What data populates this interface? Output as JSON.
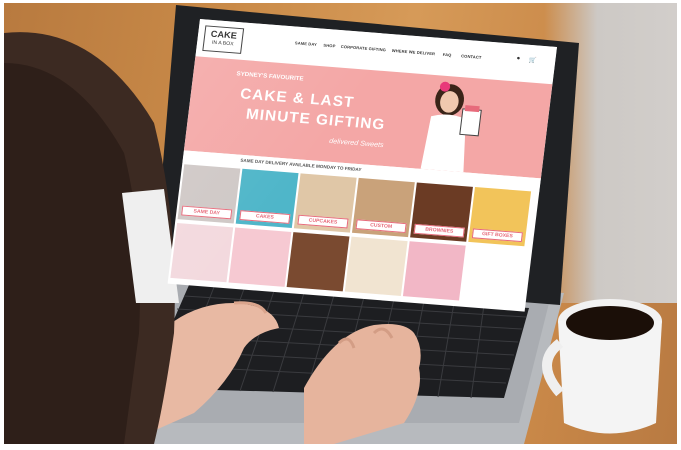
{
  "scene": {
    "colors": {
      "table": "#c98a48",
      "wall": "#d2cecb",
      "laptop": "#b9bcc0",
      "screen_bezel": "#1f2124",
      "hero_pink": "#f4a7a6",
      "label_pink": "#e76b7b",
      "coffee": "#1b0f08"
    }
  },
  "website": {
    "logo": {
      "line1": "CAKE",
      "line2": "IN A BOX"
    },
    "nav": [
      "SAME DAY",
      "SHOP",
      "CORPORATE GIFTING",
      "WHERE WE DELIVER",
      "FAQ",
      "CONTACT"
    ],
    "nav_icons": [
      "user-icon",
      "cart-icon"
    ],
    "hero": {
      "small_line": "SYDNEY'S FAVOURITE",
      "headline_line1": "CAKE & LAST",
      "headline_line2": "MINUTE GIFTING",
      "script_line": "delivered Sweets"
    },
    "delivery_banner": "SAME DAY DELIVERY AVAILABLE MONDAY TO FRIDAY",
    "tiles": [
      "SAME DAY",
      "CAKES",
      "CUPCAKES",
      "CUSTOM",
      "BROWNIES",
      "GIFT BOXES",
      "",
      "",
      "",
      "",
      "",
      ""
    ]
  }
}
